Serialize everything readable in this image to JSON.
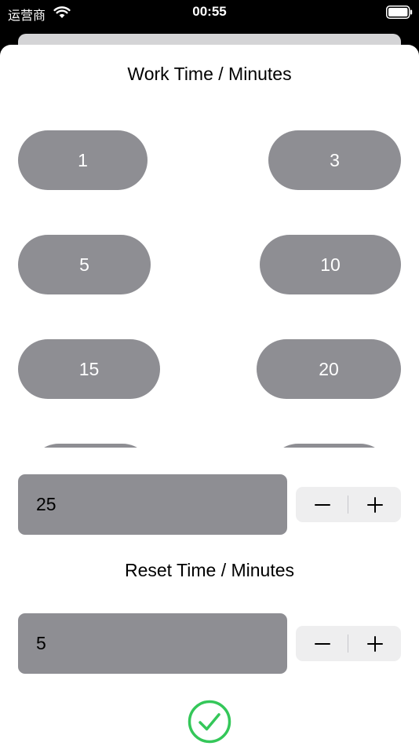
{
  "status_bar": {
    "carrier": "运营商",
    "time": "00:55"
  },
  "work_section": {
    "title": "Work Time  /  Minutes",
    "options": [
      "1",
      "3",
      "5",
      "10",
      "15",
      "20"
    ],
    "value": "25"
  },
  "reset_section": {
    "title": "Reset Time  /  Minutes",
    "value": "5"
  },
  "stepper": {
    "minus_icon": "minus-icon",
    "plus_icon": "plus-icon"
  },
  "confirm": {
    "icon": "checkmark-circle-icon",
    "color": "#34c759"
  },
  "colors": {
    "pill": "#8e8e93",
    "stepper_bg": "#eeeeef"
  }
}
